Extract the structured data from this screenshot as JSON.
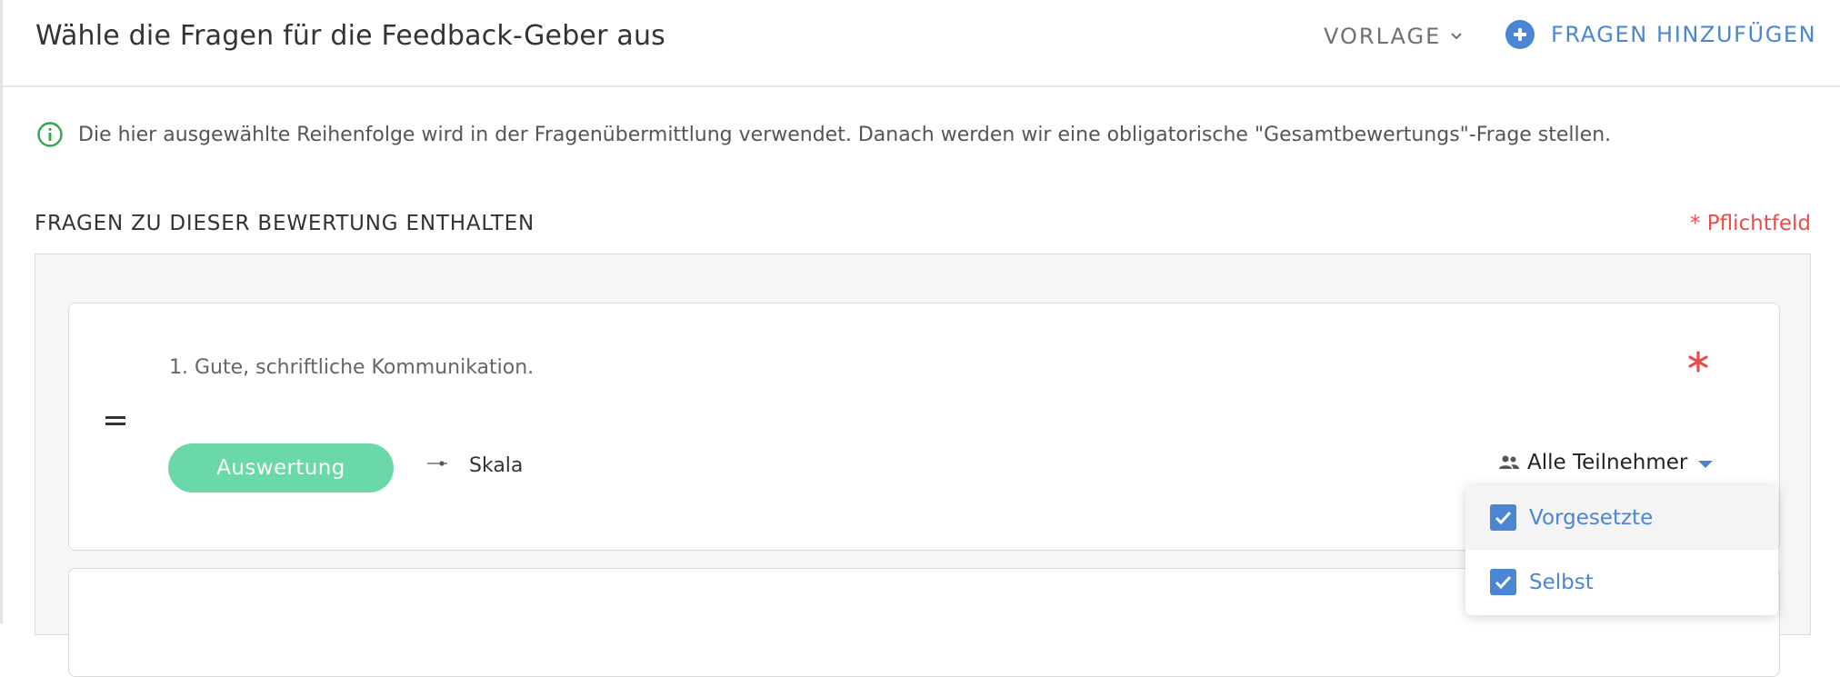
{
  "header": {
    "title": "Wähle die Fragen für die Feedback-Geber aus",
    "template_label": "VORLAGE",
    "add_questions_label": "FRAGEN HINZUFÜGEN"
  },
  "info": {
    "text": "Die hier ausgewählte Reihenfolge wird in der Fragenübermittlung verwendet. Danach werden wir eine obligatorische \"Gesamtbewertungs\"-Frage stellen."
  },
  "section": {
    "title": "FRAGEN ZU DIESER BEWERTUNG ENTHALTEN",
    "required_note": "* Pflichtfeld"
  },
  "questions": [
    {
      "text": "1. Gute, schriftliche Kommunikation.",
      "evaluation_label": "Auswertung",
      "scale_label": "Skala",
      "participants_label": "Alle Teilnehmer"
    }
  ],
  "participants_dropdown": {
    "options": [
      {
        "label": "Vorgesetzte",
        "checked": true
      },
      {
        "label": "Selbst",
        "checked": true
      }
    ]
  },
  "colors": {
    "accent": "#4a86d4",
    "evaluation_button": "#6ad8a9",
    "required": "#e84c4c",
    "info_icon": "#2fa84f"
  }
}
